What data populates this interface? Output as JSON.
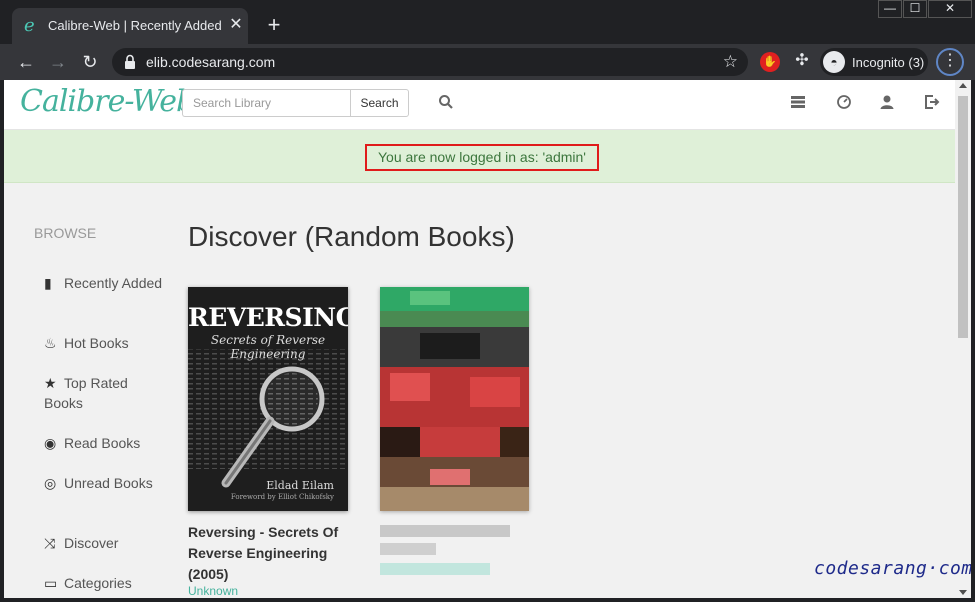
{
  "browser": {
    "tab_title": "Calibre-Web | Recently Added Bo",
    "tab_favicon": "e",
    "tab_close": "✕",
    "new_tab": "+",
    "url": "elib.codesarang.com",
    "incognito_label": "Incognito (3)",
    "window_controls": {
      "minimize": "—",
      "maximize": "☐",
      "close": "✕"
    }
  },
  "app": {
    "logo": "Calibre-Web",
    "search_placeholder": "Search Library",
    "search_button": "Search",
    "alert": "You are now logged in as: 'admin'"
  },
  "sidebar": {
    "heading": "BROWSE",
    "items": [
      {
        "icon": "book-icon",
        "glyph": "▮",
        "label": "Recently Added"
      },
      {
        "icon": "fire-icon",
        "glyph": "♨",
        "label": "Hot Books"
      },
      {
        "icon": "star-icon",
        "glyph": "★",
        "label": "Top Rated Books"
      },
      {
        "icon": "eye-icon",
        "glyph": "◉",
        "label": "Read Books"
      },
      {
        "icon": "eye-slash-icon",
        "glyph": "◎",
        "label": "Unread Books"
      },
      {
        "icon": "shuffle-icon",
        "glyph": "⤨",
        "label": "Discover"
      },
      {
        "icon": "inbox-icon",
        "glyph": "▭",
        "label": "Categories"
      }
    ]
  },
  "main": {
    "title": "Discover (Random Books)",
    "books": [
      {
        "title": "Reversing - Secrets Of Reverse Engineering (2005)",
        "author": "Unknown",
        "cover_title": "REVERSING",
        "cover_subtitle": "Secrets of Reverse Engineering",
        "cover_author": "Eldad Eilam",
        "cover_foreword": "Foreword by Elliot Chikofsky"
      }
    ]
  },
  "watermark": "codesarang·com",
  "colors": {
    "accent": "#45b29d",
    "alert_bg": "#dff0d8",
    "alert_text": "#3c763d",
    "highlight_box": "#e01b1b"
  }
}
